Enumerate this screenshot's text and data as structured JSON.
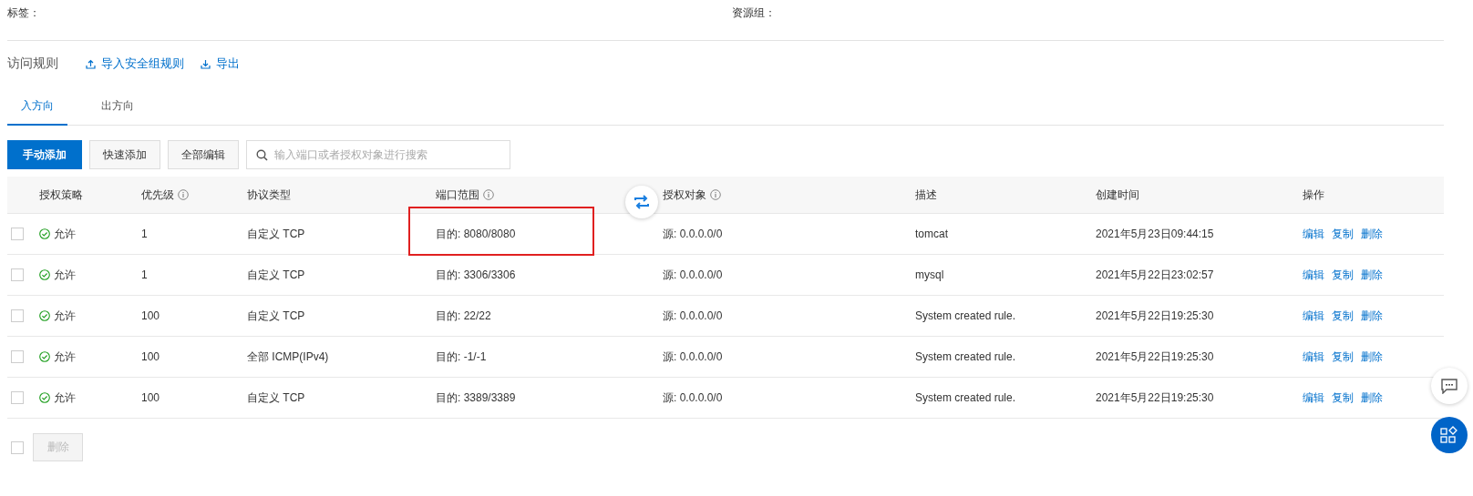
{
  "info": [
    {
      "label": "标签："
    },
    {
      "label": "资源组："
    }
  ],
  "section": {
    "title": "访问规则",
    "links": [
      {
        "label": "导入安全组规则",
        "kind": "upload"
      },
      {
        "label": "导出",
        "kind": "download"
      }
    ]
  },
  "tabs": [
    {
      "label": "入方向",
      "selected": true
    },
    {
      "label": "出方向",
      "selected": false
    }
  ],
  "toolbar": {
    "buttons": [
      {
        "label": "手动添加",
        "kind": "primary"
      },
      {
        "label": "快速添加",
        "kind": "default"
      },
      {
        "label": "全部编辑",
        "kind": "default"
      }
    ],
    "search": {
      "placeholder": "输入端口或者授权对象进行搜索"
    }
  },
  "table": {
    "columns": [
      {
        "label": "授权策略",
        "info": false
      },
      {
        "label": "优先级",
        "info": true
      },
      {
        "label": "协议类型",
        "info": false
      },
      {
        "label": "端口范围",
        "info": true
      },
      {
        "label": "授权对象",
        "info": true
      },
      {
        "label": "描述",
        "info": false
      },
      {
        "label": "创建时间",
        "info": false
      },
      {
        "label": "操作",
        "info": false
      }
    ],
    "rows": [
      {
        "checked": false,
        "policy": "允许",
        "priority": "1",
        "protocol": "自定义 TCP",
        "port": "目的: 8080/8080",
        "port_highlighted": true,
        "source": "源: 0.0.0.0/0",
        "description": "tomcat",
        "created": "2021年5月23日09:44:15",
        "actions": [
          "编辑",
          "复制",
          "删除"
        ]
      },
      {
        "checked": false,
        "policy": "允许",
        "priority": "1",
        "protocol": "自定义 TCP",
        "port": "目的: 3306/3306",
        "port_highlighted": false,
        "source": "源: 0.0.0.0/0",
        "description": "mysql",
        "created": "2021年5月22日23:02:57",
        "actions": [
          "编辑",
          "复制",
          "删除"
        ]
      },
      {
        "checked": false,
        "policy": "允许",
        "priority": "100",
        "protocol": "自定义 TCP",
        "port": "目的: 22/22",
        "port_highlighted": false,
        "source": "源: 0.0.0.0/0",
        "description": "System created rule.",
        "created": "2021年5月22日19:25:30",
        "actions": [
          "编辑",
          "复制",
          "删除"
        ]
      },
      {
        "checked": false,
        "policy": "允许",
        "priority": "100",
        "protocol": "全部 ICMP(IPv4)",
        "port": "目的: -1/-1",
        "port_highlighted": false,
        "source": "源: 0.0.0.0/0",
        "description": "System created rule.",
        "created": "2021年5月22日19:25:30",
        "actions": [
          "编辑",
          "复制",
          "删除"
        ]
      },
      {
        "checked": false,
        "policy": "允许",
        "priority": "100",
        "protocol": "自定义 TCP",
        "port": "目的: 3389/3389",
        "port_highlighted": false,
        "source": "源: 0.0.0.0/0",
        "description": "System created rule.",
        "created": "2021年5月22日19:25:30",
        "actions": [
          "编辑",
          "复制",
          "删除"
        ]
      }
    ]
  },
  "footer": {
    "select_all_checked": false,
    "delete_button": {
      "label": "删除",
      "disabled": true
    }
  }
}
